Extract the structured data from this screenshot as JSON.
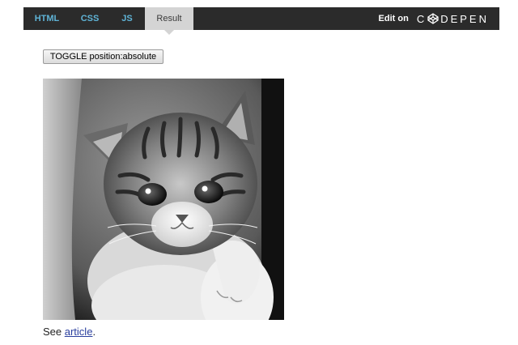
{
  "tabs": [
    {
      "label": "HTML",
      "active": false
    },
    {
      "label": "CSS",
      "active": false
    },
    {
      "label": "JS",
      "active": false
    },
    {
      "label": "Result",
      "active": true
    }
  ],
  "edit_on": {
    "label": "Edit on",
    "logo_first": "C",
    "logo_rest": "DEPEN",
    "logo_icon": "codepen-cube-icon"
  },
  "toggle_button": {
    "label": "TOGGLE position:absolute"
  },
  "image": {
    "subject": "kitten-photo",
    "tone": "grayscale"
  },
  "caption": {
    "prefix": "See ",
    "link_label": "article",
    "suffix": "."
  },
  "colors": {
    "bar_bg": "#2b2b2b",
    "tab_text": "#5fb3d6",
    "active_tab_bg": "#d4d4d4",
    "link": "#2a3f9e"
  }
}
